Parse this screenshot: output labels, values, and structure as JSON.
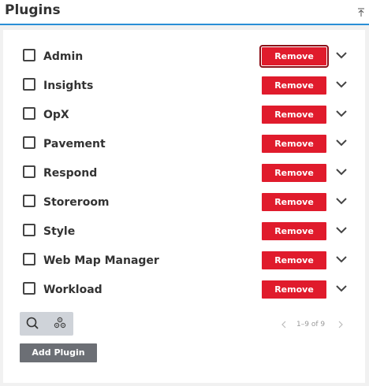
{
  "header": {
    "title": "Plugins"
  },
  "plugins": [
    {
      "name": "Admin",
      "action": "Remove"
    },
    {
      "name": "Insights",
      "action": "Remove"
    },
    {
      "name": "OpX",
      "action": "Remove"
    },
    {
      "name": "Pavement",
      "action": "Remove"
    },
    {
      "name": "Respond",
      "action": "Remove"
    },
    {
      "name": "Storeroom",
      "action": "Remove"
    },
    {
      "name": "Style",
      "action": "Remove"
    },
    {
      "name": "Web Map Manager",
      "action": "Remove"
    },
    {
      "name": "Workload",
      "action": "Remove"
    }
  ],
  "pager": {
    "text": "1–9 of 9"
  },
  "footer": {
    "add_label": "Add Plugin"
  },
  "colors": {
    "accent": "#2a8fd6",
    "danger": "#e01b2c",
    "muted_button": "#6c6f75"
  },
  "icons": [
    "collapse-up-icon",
    "chevron-down-icon",
    "search-icon",
    "gears-icon",
    "chevron-left-icon",
    "chevron-right-icon"
  ]
}
